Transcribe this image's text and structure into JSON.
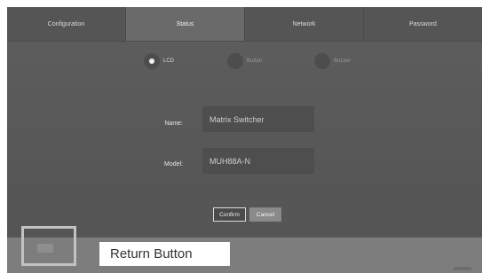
{
  "tabs": [
    {
      "label": "Configuration",
      "active": false
    },
    {
      "label": "Status",
      "active": true
    },
    {
      "label": "Network",
      "active": false
    },
    {
      "label": "Password",
      "active": false
    }
  ],
  "radios": [
    {
      "label": "LCD",
      "selected": true
    },
    {
      "label": "Button",
      "selected": false
    },
    {
      "label": "Buzzer",
      "selected": false
    }
  ],
  "form": {
    "name_label": "Name:",
    "name_value": "Matrix Switcher",
    "model_label": "Model:",
    "model_value": "MUH88A-N"
  },
  "buttons": {
    "confirm": "Confirm",
    "cancel": "Cancel"
  },
  "return_button": {
    "icon": "return-icon",
    "callout_label": "Return Button"
  }
}
